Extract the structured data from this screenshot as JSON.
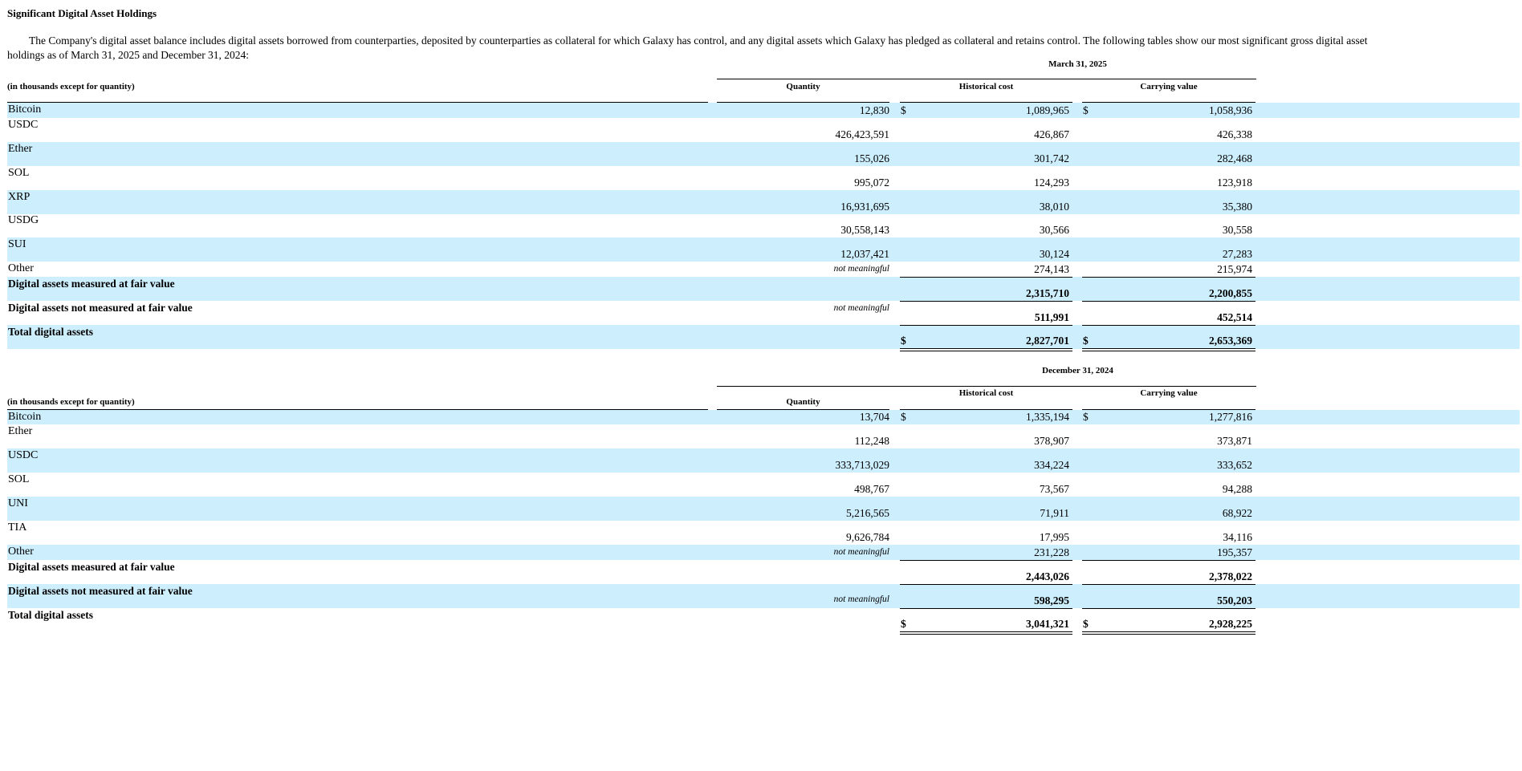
{
  "title": "Significant Digital Asset Holdings",
  "intro_line1": "The Company's digital asset balance includes digital assets borrowed from counterparties, deposited by counterparties as collateral for which Galaxy has control, and any digital assets which Galaxy has pledged as collateral and retains control. The following tables show our most significant gross digital asset",
  "intro_line2": "holdings as of March 31, 2025 and December 31, 2024:",
  "dollar_sign": "$",
  "tables": [
    {
      "period": "March 31, 2025",
      "units_label": "(in thousands except for quantity)",
      "col_quantity": "Quantity",
      "col_historical": "Historical cost",
      "col_carrying": "Carrying value",
      "rows": [
        {
          "label": "Bitcoin",
          "quantity": "12,830",
          "historical": "1,089,965",
          "carrying": "1,058,936"
        },
        {
          "label": "USDC",
          "quantity": "426,423,591",
          "historical": "426,867",
          "carrying": "426,338"
        },
        {
          "label": "Ether",
          "quantity": "155,026",
          "historical": "301,742",
          "carrying": "282,468"
        },
        {
          "label": "SOL",
          "quantity": "995,072",
          "historical": "124,293",
          "carrying": "123,918"
        },
        {
          "label": "XRP",
          "quantity": "16,931,695",
          "historical": "38,010",
          "carrying": "35,380"
        },
        {
          "label": "USDG",
          "quantity": "30,558,143",
          "historical": "30,566",
          "carrying": "30,558"
        },
        {
          "label": "SUI",
          "quantity": "12,037,421",
          "historical": "30,124",
          "carrying": "27,283"
        },
        {
          "label": "Other",
          "quantity": "not meaningful",
          "historical": "274,143",
          "carrying": "215,974"
        }
      ],
      "fair_value": {
        "label": "Digital assets measured at fair value",
        "historical": "2,315,710",
        "carrying": "2,200,855"
      },
      "not_fair_value": {
        "label": "Digital assets not measured at fair value",
        "quantity": "not meaningful",
        "historical": "511,991",
        "carrying": "452,514"
      },
      "total": {
        "label": "Total digital assets",
        "historical": "2,827,701",
        "carrying": "2,653,369"
      }
    },
    {
      "period": "December 31, 2024",
      "units_label": "(in thousands except for quantity)",
      "col_quantity": "Quantity",
      "col_historical": "Historical cost",
      "col_carrying": "Carrying value",
      "rows": [
        {
          "label": "Bitcoin",
          "quantity": "13,704",
          "historical": "1,335,194",
          "carrying": "1,277,816"
        },
        {
          "label": "Ether",
          "quantity": "112,248",
          "historical": "378,907",
          "carrying": "373,871"
        },
        {
          "label": "USDC",
          "quantity": "333,713,029",
          "historical": "334,224",
          "carrying": "333,652"
        },
        {
          "label": "SOL",
          "quantity": "498,767",
          "historical": "73,567",
          "carrying": "94,288"
        },
        {
          "label": "UNI",
          "quantity": "5,216,565",
          "historical": "71,911",
          "carrying": "68,922"
        },
        {
          "label": "TIA",
          "quantity": "9,626,784",
          "historical": "17,995",
          "carrying": "34,116"
        },
        {
          "label": "Other",
          "quantity": "not meaningful",
          "historical": "231,228",
          "carrying": "195,357"
        }
      ],
      "fair_value": {
        "label": "Digital assets measured at fair value",
        "historical": "2,443,026",
        "carrying": "2,378,022"
      },
      "not_fair_value": {
        "label": "Digital assets not measured at fair value",
        "quantity": "not meaningful",
        "historical": "598,295",
        "carrying": "550,203"
      },
      "total": {
        "label": "Total digital assets",
        "historical": "3,041,321",
        "carrying": "2,928,225"
      }
    }
  ],
  "colors": {
    "band": "#cdeefd",
    "text": "#000000"
  }
}
